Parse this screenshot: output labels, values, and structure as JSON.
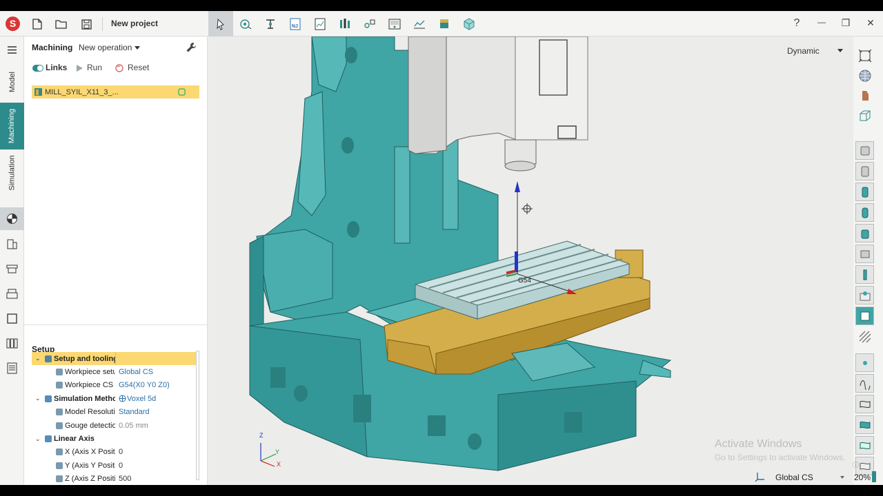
{
  "app": {
    "project_title": "New project"
  },
  "window": {
    "help": "?",
    "minimize": "—",
    "maximize": "❐",
    "close": "✕"
  },
  "ribbon": {
    "items": [
      "select-tool",
      "workpiece",
      "fixture",
      "nc-program",
      "toolpath",
      "tools",
      "setup",
      "machine",
      "chart",
      "stock",
      "package"
    ]
  },
  "leftrail": {
    "tabs": [
      "Model",
      "Machining",
      "Simulation"
    ],
    "active": "Machining"
  },
  "panel": {
    "header_title": "Machining",
    "operation_selector": "New operation",
    "links_label": "Links",
    "run_label": "Run",
    "reset_label": "Reset",
    "operation_item": "MILL_SYIL_X11_3_...",
    "setup_title": "Setup",
    "tree": [
      {
        "label": "Setup and tooling",
        "value": "",
        "level": 0,
        "expanded": true,
        "bold": true,
        "highlight": true,
        "icon": "wrench-icon"
      },
      {
        "label": "Workpiece setup",
        "value": "Global CS",
        "level": 1,
        "icon": "workpiece-icon"
      },
      {
        "label": "Workpiece CS",
        "value": "G54(X0 Y0 Z0)",
        "level": 1,
        "icon": "cs-icon"
      },
      {
        "label": "Simulation Method",
        "value": "Voxel 5d",
        "level": 0,
        "expanded": true,
        "bold": true,
        "icon": "globe-icon"
      },
      {
        "label": "Model Resolution",
        "value": "Standard",
        "level": 1,
        "icon": "model-icon"
      },
      {
        "label": "Gouge detection to",
        "value": "0.05 mm",
        "level": 1,
        "icon": "gouge-icon",
        "gray": true
      },
      {
        "label": "Linear Axis",
        "value": "",
        "level": 0,
        "expanded": true,
        "bold": true,
        "icon": "axis-icon"
      },
      {
        "label": "X (Axis X Position)",
        "value": "0",
        "level": 1,
        "icon": "axis-icon",
        "dark": true
      },
      {
        "label": "Y (Axis Y Position)",
        "value": "0",
        "level": 1,
        "icon": "axis-icon",
        "dark": true
      },
      {
        "label": "Z (Axis Z Position)",
        "value": "500",
        "level": 1,
        "icon": "axis-icon",
        "dark": true
      }
    ]
  },
  "viewport": {
    "view_mode": "Dynamic",
    "cs_label": "G54",
    "triad": {
      "x": "X",
      "y": "Y",
      "z": "Z"
    },
    "watermark_title": "Activate Windows",
    "watermark_sub": "Go to Settings to activate Windows.",
    "coord_system": "Global CS",
    "zoom": "20%",
    "colors": {
      "machine_body": "#3fa5a5",
      "table": "#d4ae4a",
      "spindle": "#e6e6e4",
      "accent": "#2e8b8b",
      "selection": "#fbd872"
    }
  }
}
